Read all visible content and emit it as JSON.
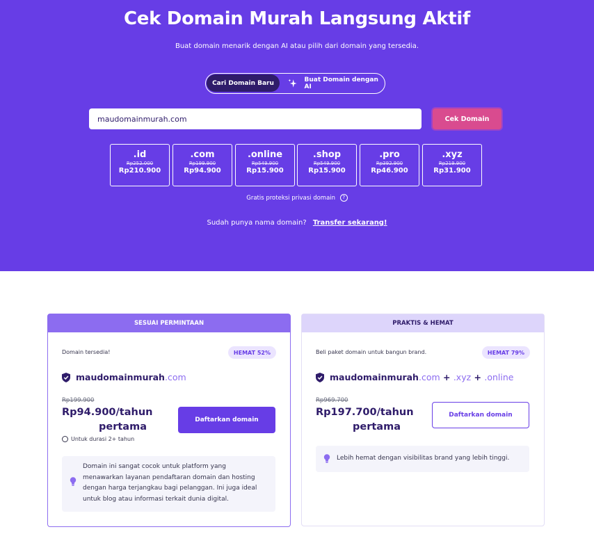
{
  "hero": {
    "title": "Cek Domain Murah Langsung Aktif",
    "subtitle": "Buat domain menarik dengan AI atau pilih dari domain yang tersedia.",
    "toggle": {
      "active_label": "Cari Domain Baru",
      "ai_label": "Buat Domain dengan AI"
    },
    "search": {
      "value": "maudomainmurah.com",
      "button_label": "Cek Domain"
    },
    "tlds": [
      {
        "name": ".id",
        "old_price": "Rp252.000",
        "price": "Rp210.900"
      },
      {
        "name": ".com",
        "old_price": "Rp199.900",
        "price": "Rp94.900"
      },
      {
        "name": ".online",
        "old_price": "Rp549.900",
        "price": "Rp15.900"
      },
      {
        "name": ".shop",
        "old_price": "Rp549.900",
        "price": "Rp15.900"
      },
      {
        "name": ".pro",
        "old_price": "Rp392.900",
        "price": "Rp46.900"
      },
      {
        "name": ".xyz",
        "old_price": "Rp219.900",
        "price": "Rp31.900"
      }
    ],
    "privacy_text": "Gratis proteksi privasi domain",
    "transfer_text": "Sudah punya nama domain?",
    "transfer_link": "Transfer sekarang!"
  },
  "cards": {
    "left": {
      "header": "SESUAI PERMINTAAN",
      "note": "Domain tersedia!",
      "badge": "HEMAT 52%",
      "domain_base": "maudomainmurah",
      "domain_tld": ".com",
      "old_price": "Rp199.900",
      "price_line1": "Rp94.900/tahun",
      "price_line2": "pertama",
      "button_label": "Daftarkan domain",
      "duration": "Untuk durasi 2+ tahun",
      "info": "Domain ini sangat cocok untuk platform yang menawarkan layanan pendaftaran domain dan hosting dengan harga terjangkau bagi pelanggan. Ini juga ideal untuk blog atau informasi terkait dunia digital."
    },
    "right": {
      "header": "PRAKTIS & HEMAT",
      "note": "Beli paket domain untuk bangun brand.",
      "badge": "HEMAT 79%",
      "domain_base": "maudomainmurah",
      "domain_tld1": ".com",
      "plus1": " + ",
      "domain_tld2": ".xyz",
      "plus2": " + ",
      "domain_tld3": ".online",
      "old_price": "Rp969.700",
      "price_line1": "Rp197.700/tahun",
      "price_line2": "pertama",
      "button_label": "Daftarkan domain",
      "info": "Lebih hemat dengan visibilitas brand yang lebih tinggi."
    }
  },
  "colors": {
    "brand": "#673de6",
    "dark": "#2f1c6a",
    "accent": "#8c6cf0",
    "cta": "#d94b8f"
  },
  "icons": [
    "sparkle-icon",
    "help-icon",
    "shield-check-icon",
    "clock-icon",
    "lightbulb-icon"
  ]
}
